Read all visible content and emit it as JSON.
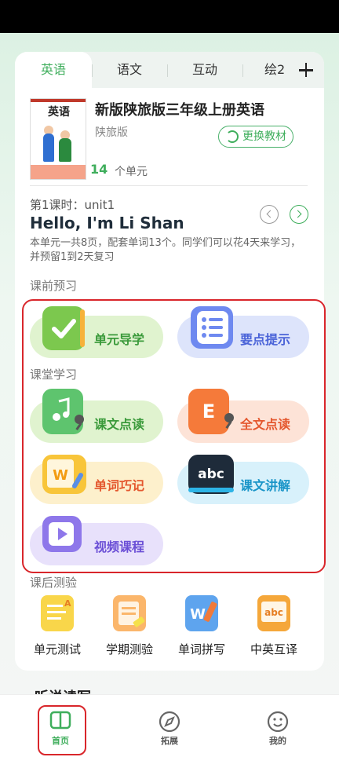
{
  "tabs": [
    {
      "label": "英语",
      "active": true
    },
    {
      "label": "语文",
      "active": false
    },
    {
      "label": "互动",
      "active": false
    },
    {
      "label": "绘2",
      "active": false
    }
  ],
  "book": {
    "cover_title": "英语",
    "name": "新版陕旅版三年级上册英语",
    "publisher": "陕旅版",
    "change_label": "更换教材",
    "unit_count": "14",
    "unit_label": "个单元"
  },
  "lesson": {
    "number": "第1课时：unit1",
    "title": "Hello, I'm Li Shan",
    "description": "本单元一共8页，配套单词13个。同学们可以花4天来学习，并预留1到2天复习"
  },
  "sections": {
    "preview": "课前预习",
    "classroom": "课堂学习",
    "after": "课后测验"
  },
  "features": {
    "unit_guide": "单元导学",
    "key_points": "要点提示",
    "text_reading": "课文点读",
    "full_reading": "全文点读",
    "word_memory": "单词巧记",
    "text_explain": "课文讲解",
    "video_course": "视频课程"
  },
  "after_items": [
    "单元测试",
    "学期测验",
    "单词拼写",
    "中英互译"
  ],
  "peek_heading": "听说读写",
  "bottom_nav": [
    {
      "label": "首页",
      "active": true
    },
    {
      "label": "拓展",
      "active": false
    },
    {
      "label": "我的",
      "active": false
    }
  ],
  "colors": {
    "accent": "#3fae5c",
    "highlight": "#d9262b"
  }
}
